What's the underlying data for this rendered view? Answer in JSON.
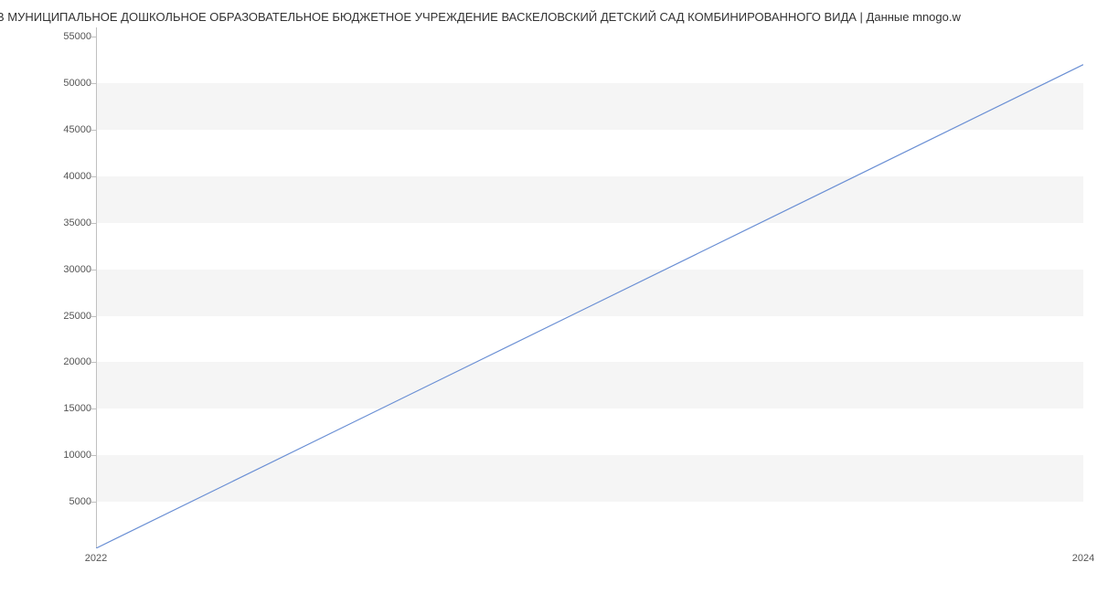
{
  "chart_data": {
    "type": "line",
    "title": "ЛАТА В МУНИЦИПАЛЬНОЕ ДОШКОЛЬНОЕ ОБРАЗОВАТЕЛЬНОЕ БЮДЖЕТНОЕ УЧРЕЖДЕНИЕ  ВАСКЕЛОВСКИЙ ДЕТСКИЙ САД КОМБИНИРОВАННОГО ВИДА | Данные mnogo.w",
    "xlabel": "",
    "ylabel": "",
    "x": [
      2022,
      2024
    ],
    "values": [
      0,
      52000
    ],
    "x_ticks": [
      2022,
      2024
    ],
    "y_ticks": [
      5000,
      10000,
      15000,
      20000,
      25000,
      30000,
      35000,
      40000,
      45000,
      50000,
      55000
    ],
    "ylim": [
      0,
      56000
    ],
    "xlim": [
      2022,
      2024
    ],
    "colors": {
      "line": "#6a8fd4",
      "band": "#f5f5f5"
    }
  }
}
